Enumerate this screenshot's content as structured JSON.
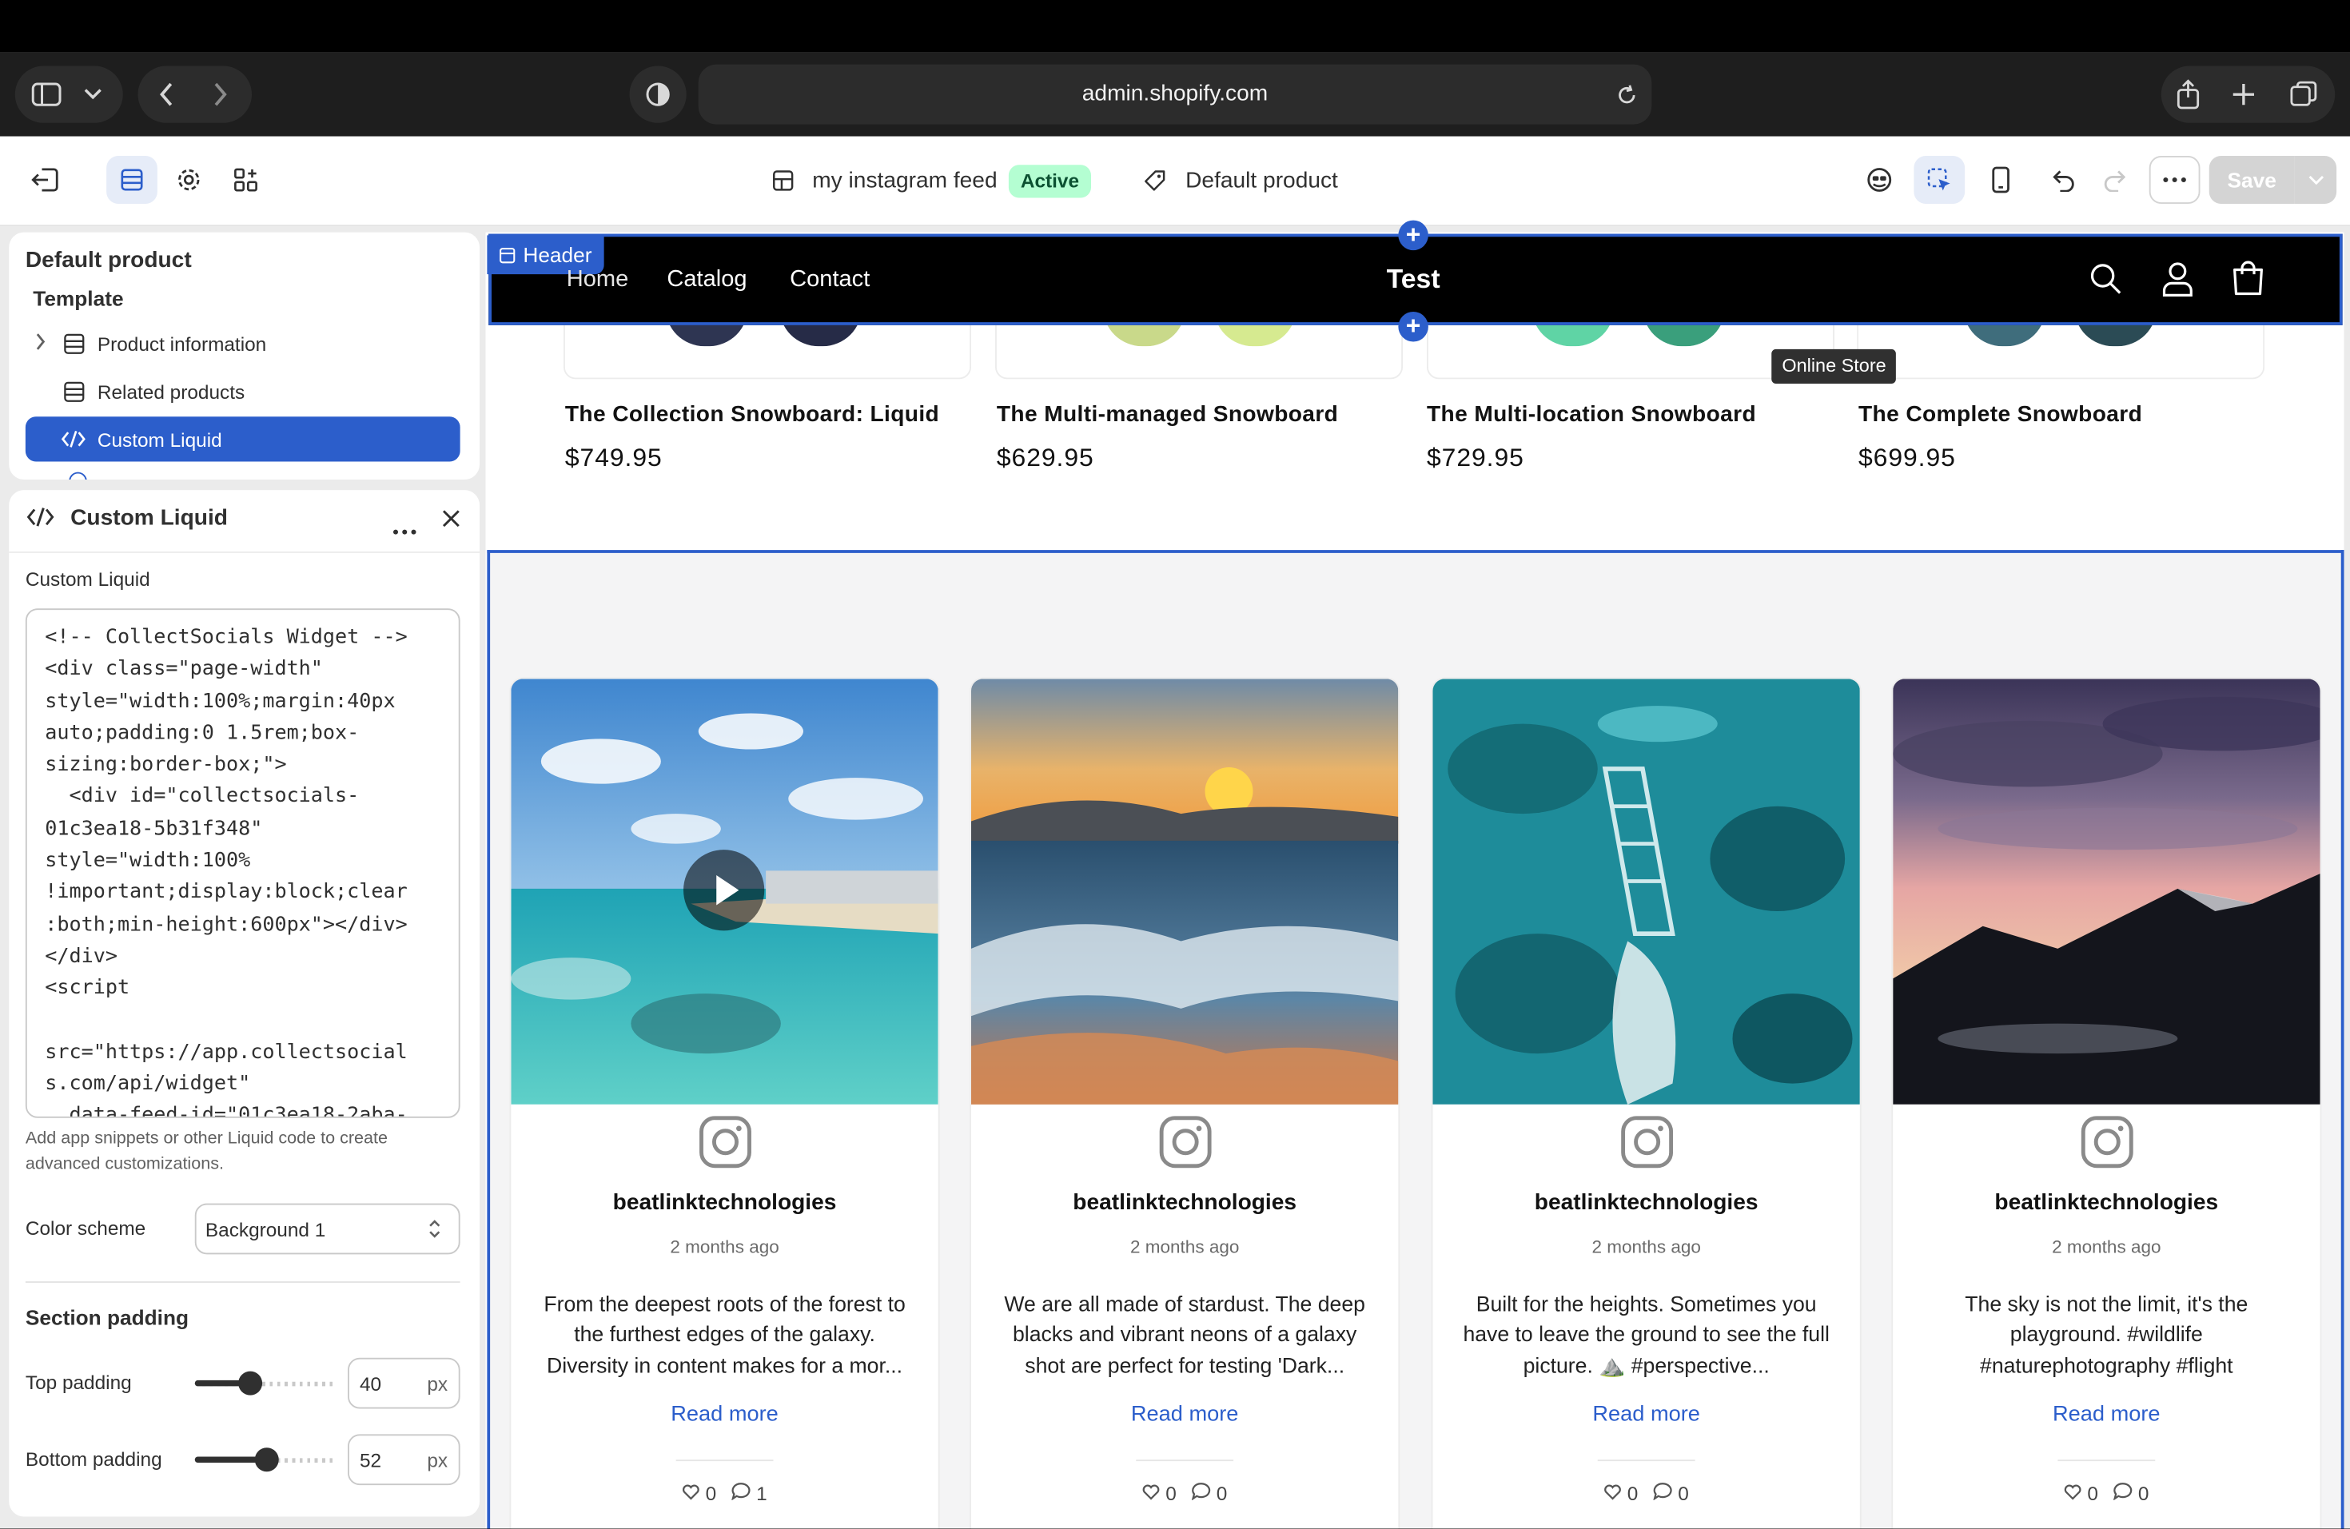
{
  "browser": {
    "url": "admin.shopify.com"
  },
  "toolbar": {
    "theme_name": "my instagram feed",
    "status_badge": "Active",
    "template_name": "Default product",
    "save_label": "Save"
  },
  "sidebar": {
    "title": "Default product",
    "section_heading": "Template",
    "items": [
      {
        "label": "Product information"
      },
      {
        "label": "Related products"
      },
      {
        "label": "Custom Liquid"
      }
    ]
  },
  "settings": {
    "title": "Custom Liquid",
    "field_label": "Custom Liquid",
    "code": "<!-- CollectSocials Widget -->\n<div class=\"page-width\"\nstyle=\"width:100%;margin:40px\nauto;padding:0 1.5rem;box-\nsizing:border-box;\">\n  <div id=\"collectsocials-\n01c3ea18-5b31f348\"\nstyle=\"width:100%\n!important;display:block;clear\n:both;min-height:600px\"></div>\n</div>\n<script\n\nsrc=\"https://app.collectsocial\ns.com/api/widget\"\n  data-feed-id=\"01c3ea18-2aba-",
    "help_text": "Add app snippets or other Liquid code to create advanced customizations.",
    "color_scheme_label": "Color scheme",
    "color_scheme_value": "Background 1",
    "padding_heading": "Section padding",
    "top_padding_label": "Top padding",
    "top_padding_value": "40",
    "top_padding_fraction": 0.4,
    "bottom_padding_label": "Bottom padding",
    "bottom_padding_value": "52",
    "bottom_padding_fraction": 0.52,
    "unit": "px"
  },
  "preview": {
    "header_tag": "Header",
    "nav": [
      "Home",
      "Catalog",
      "Contact"
    ],
    "store_name": "Test",
    "tooltip": "Online Store",
    "products": [
      {
        "title": "The Collection Snowboard: Liquid",
        "price": "$749.95"
      },
      {
        "title": "The Multi-managed Snowboard",
        "price": "$629.95"
      },
      {
        "title": "The Multi-location Snowboard",
        "price": "$729.95"
      },
      {
        "title": "The Complete Snowboard",
        "price": "$699.95"
      }
    ],
    "posts": [
      {
        "user": "beatlinktechnologies",
        "ago": "2 months ago",
        "caption": "From the deepest roots of the forest to the furthest edges of the galaxy. Diversity in content makes for a mor...",
        "more": "Read more",
        "likes": "0",
        "comments": "1"
      },
      {
        "user": "beatlinktechnologies",
        "ago": "2 months ago",
        "caption": "We are all made of stardust. The deep blacks and vibrant neons of a galaxy shot are perfect for testing 'Dark...",
        "more": "Read more",
        "likes": "0",
        "comments": "0"
      },
      {
        "user": "beatlinktechnologies",
        "ago": "2 months ago",
        "caption": "Built for the heights. Sometimes you have to leave the ground to see the full picture. ⛰️ #perspective...",
        "more": "Read more",
        "likes": "0",
        "comments": "0"
      },
      {
        "user": "beatlinktechnologies",
        "ago": "2 months ago",
        "caption": "The sky is not the limit, it's the playground. #wildlife #naturephotography #flight",
        "more": "Read more",
        "likes": "0",
        "comments": "0"
      }
    ]
  },
  "colors": {
    "accent": "#2c5ecb",
    "active_badge_bg": "#b4fed2",
    "store_header_bg": "#000000"
  }
}
